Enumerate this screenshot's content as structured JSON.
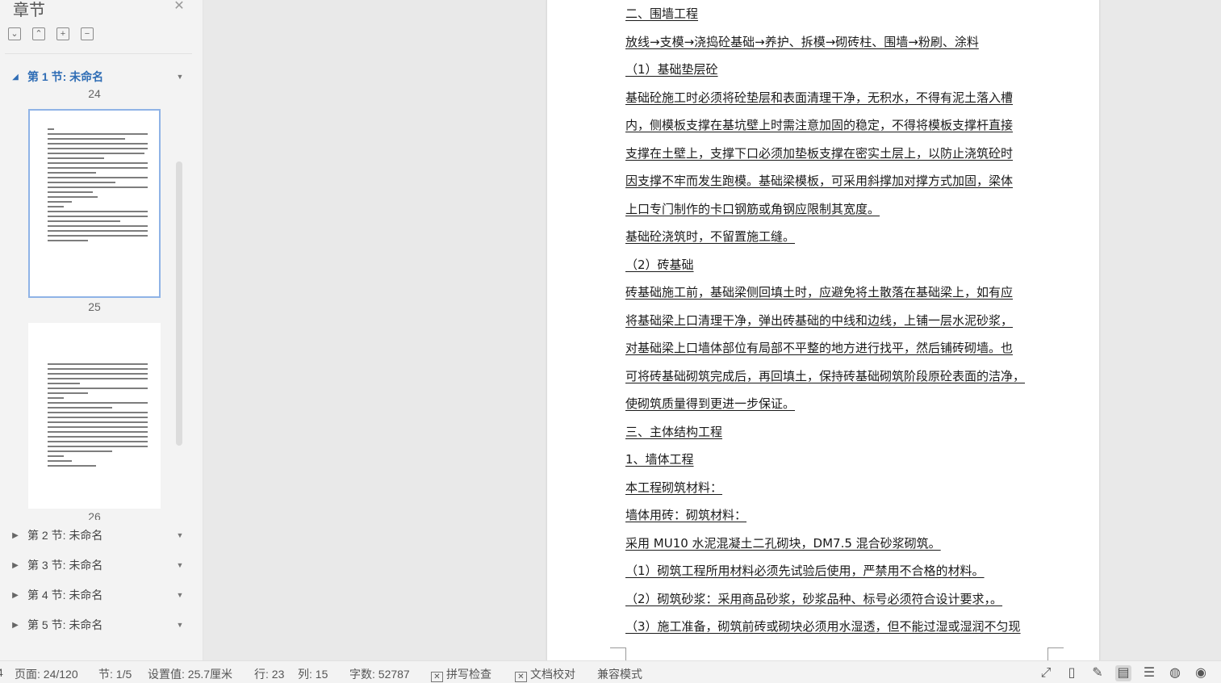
{
  "sidebar": {
    "title": "章节",
    "close_icon": "close-icon",
    "tools": [
      "collapse-all-icon",
      "expand-all-icon",
      "add-section-icon",
      "remove-section-icon"
    ],
    "sections": [
      {
        "label": "第 1 节: 未命名",
        "expanded": true
      },
      {
        "label": "第 2 节: 未命名",
        "expanded": false
      },
      {
        "label": "第 3 节: 未命名",
        "expanded": false
      },
      {
        "label": "第 4 节: 未命名",
        "expanded": false
      },
      {
        "label": "第 5 节: 未命名",
        "expanded": false
      }
    ],
    "page_numbers": [
      "24",
      "25",
      "26"
    ],
    "accent_color": "#2f6db5"
  },
  "document": {
    "paragraphs": [
      "二、围墙工程",
      " 放线→支模→浇捣砼基础→养护、拆模→砌砖柱、围墙→粉刷、涂料",
      " （1）基础垫层砼",
      "基础砼施工时必须将砼垫层和表面清理干净，无积水，不得有泥土落入槽",
      "内，侧模板支撑在基坑壁上时需注意加固的稳定，不得将模板支撑杆直接",
      "支撑在土壁上，支撑下口必须加垫板支撑在密实土层上，以防止浇筑砼时",
      "因支撑不牢而发生跑模。基础梁模板，可采用斜撑加对撑方式加固，梁体",
      "上口专门制作的卡口钢筋或角钢应限制其宽度。",
      "基础砼浇筑时，不留置施工缝。",
      " （2）砖基础",
      "砖基础施工前，基础梁侧回填土时，应避免将土散落在基础梁上，如有应",
      "将基础梁上口清理干净，弹出砖基础的中线和边线，上铺一层水泥砂浆，",
      "对基础梁上口墙体部位有局部不平整的地方进行找平，然后铺砖砌墙。也",
      "可将砖基础砌筑完成后，再回填土，保持砖基础砌筑阶段原砼表面的洁净，",
      "使砌筑质量得到更进一步保证。",
      "三、主体结构工程",
      "1、墙体工程",
      "本工程砌筑材料：",
      "墙体用砖：砌筑材料：",
      "采用 MU10 水泥混凝土二孔砌块，DM7.5 混合砂浆砌筑。",
      "    （1）砌筑工程所用材料必须先试验后使用，严禁用不合格的材料。",
      " （2）砌筑砂浆：采用商品砂浆，砂浆品种、标号必须符合设计要求，。",
      " （3）施工准备，砌筑前砖或砌块必须用水湿透，但不能过湿或湿润不匀现"
    ]
  },
  "status_bar": {
    "page": "页面: 24/120",
    "section": "节: 1/5",
    "setting": "设置值: 25.7厘米",
    "row": "行: 23",
    "col": "列: 15",
    "word_count": "字数: 52787",
    "spell_check": "拼写检查",
    "doc_proof": "文档校对",
    "compat_mode": "兼容模式",
    "icons": [
      "fullscreen-icon",
      "read-mode-icon",
      "edit-mode-icon",
      "page-view-icon",
      "outline-view-icon",
      "web-view-icon",
      "eye-protection-icon"
    ]
  }
}
